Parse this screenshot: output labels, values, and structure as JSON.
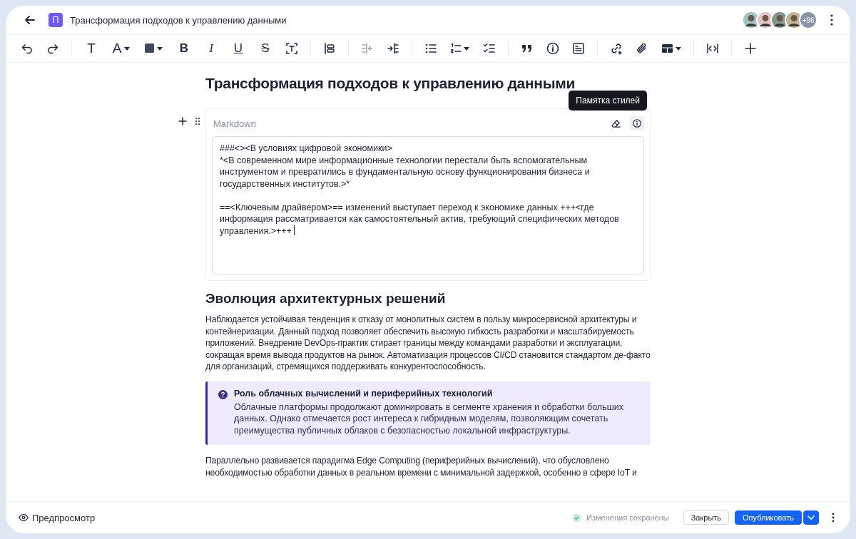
{
  "header": {
    "title": "Трансформация подходов к управлению данными",
    "space_letter": "П",
    "avatars_more": "+96"
  },
  "toolbar": {
    "text_buttons": [
      "T",
      "A",
      "B",
      "I",
      "U",
      "S"
    ],
    "outdent": {
      "disabled": true
    }
  },
  "document": {
    "title": "Трансформация подходов к управлению данными",
    "markdown_block": {
      "label": "Markdown",
      "tooltip": "Памятка стилей",
      "value": "###<><В условиях цифровой экономики>\n*<В современном мире информационные технологии перестали быть вспомогательным инструментом и превратились в фундаментальную основу функционирования бизнеса и государственных институтов.>*\n\n==<Ключевым драйвером>== изменений выступает переход к экономике данных +++<где информация рассматривается как самостоятельный актив, требующий специфических методов управления.>+++ "
    },
    "heading": "Эволюция архитектурных решений",
    "paragraph": "Наблюдается устойчивая тенденция к отказу от монолитных систем в пользу микросервисной архитектуры и контейнеризации. Данный подход позволяет обеспечить высокую гибкость разработки и масштабируемость приложений. Внедрение DevOps-практик стирает границы между командами разработки и эксплуатации, сокращая время вывода продуктов на рынок. Автоматизация процессов CI/CD становится стандартом де-факто для организаций, стремящихся поддерживать конкурентоспособность.",
    "callout": {
      "title": "Роль облачных вычислений и периферийных технологий",
      "text": "Облачные платформы продолжают доминировать в сегменте хранения и обработки больших данных. Однако отмечается рост интереса к гибридным моделям, позволяющим сочетать преимущества публичных облаков с безопасностью локальной инфраструктуры."
    },
    "paragraph_2": "Параллельно развивается парадигма Edge Computing (периферийных вычислений), что обусловлено необходимостью обработки данных в реальном времени с минимальной задержкой, особенно в сфере IoT и"
  },
  "footer": {
    "preview": "Предпросмотр",
    "status": "Изменения сохранены",
    "close": "Закрыть",
    "publish": "Опубликовать"
  }
}
